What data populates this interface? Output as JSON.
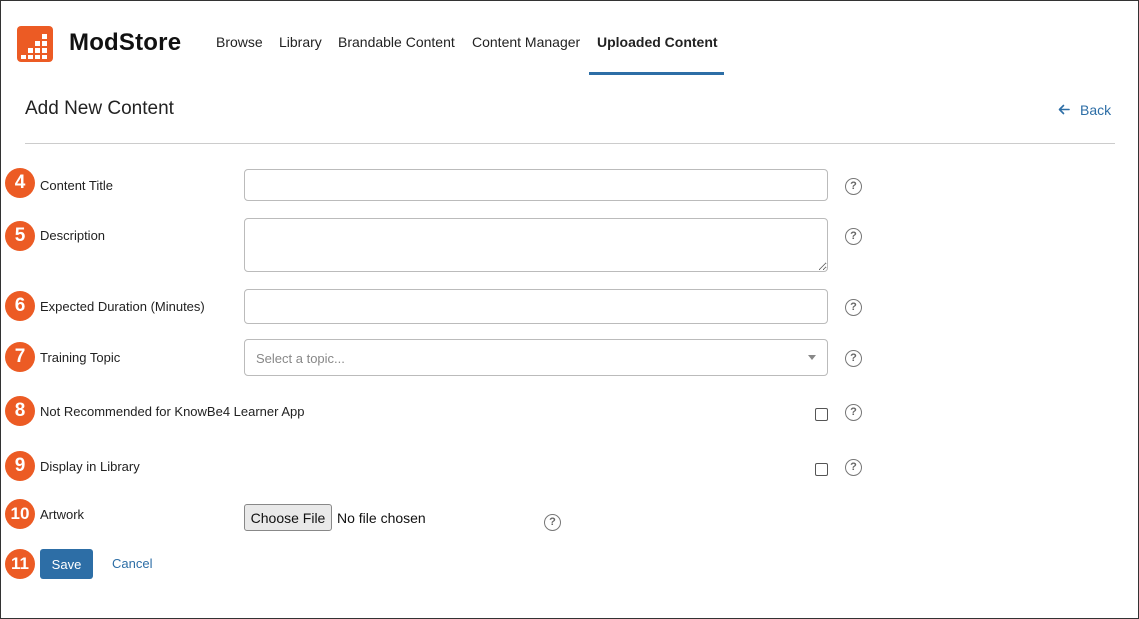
{
  "header": {
    "brand": "ModStore",
    "nav": [
      {
        "label": "Browse"
      },
      {
        "label": "Library"
      },
      {
        "label": "Brandable Content"
      },
      {
        "label": "Content Manager"
      },
      {
        "label": "Uploaded Content",
        "active": true
      }
    ]
  },
  "page": {
    "title": "Add New Content",
    "back_label": "Back",
    "back_icon": "arrow-left-icon"
  },
  "form": {
    "steps": [
      "4",
      "5",
      "6",
      "7",
      "8",
      "9",
      "10",
      "11"
    ],
    "content_title": {
      "label": "Content Title",
      "value": ""
    },
    "description": {
      "label": "Description",
      "value": ""
    },
    "duration": {
      "label": "Expected Duration (Minutes)",
      "value": ""
    },
    "topic": {
      "label": "Training Topic",
      "placeholder": "Select a topic..."
    },
    "not_recommended": {
      "label": "Not Recommended for KnowBe4 Learner App",
      "checked": false
    },
    "display_in_library": {
      "label": "Display in Library",
      "checked": false
    },
    "artwork": {
      "label": "Artwork",
      "button": "Choose File",
      "status": "No file chosen"
    },
    "help_glyph": "?",
    "save_label": "Save",
    "cancel_label": "Cancel"
  },
  "colors": {
    "accent_orange": "#ec5b24",
    "link_blue": "#2d6ea6"
  }
}
